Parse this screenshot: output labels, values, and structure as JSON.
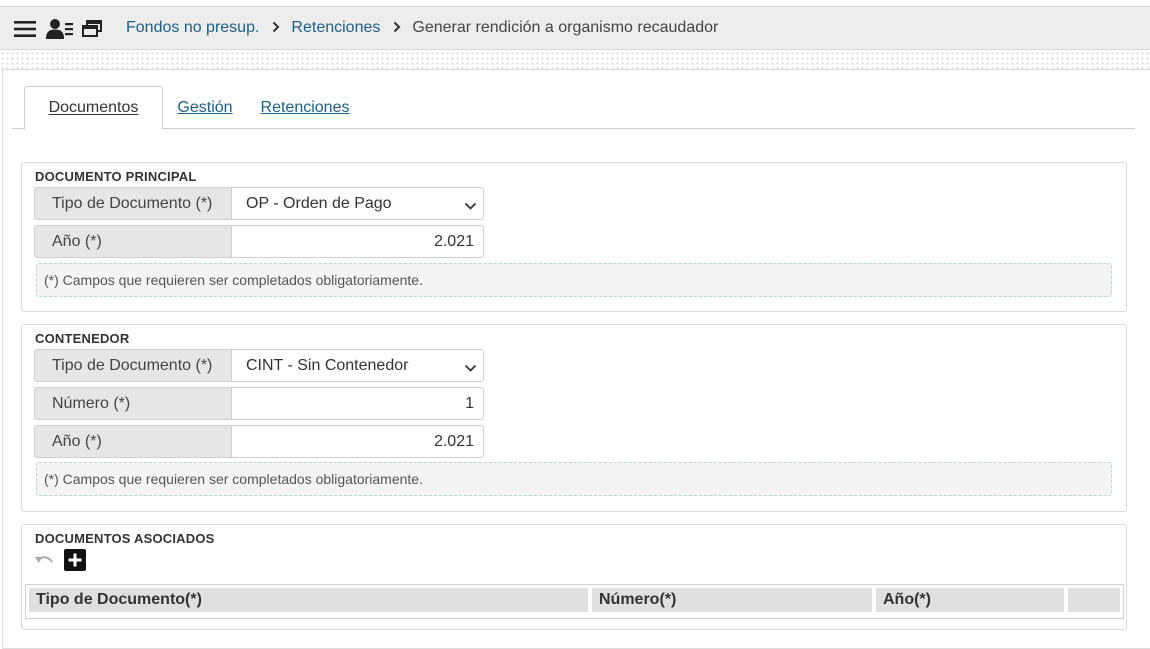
{
  "breadcrumb": {
    "items": [
      "Fondos no presup.",
      "Retenciones"
    ],
    "current": "Generar rendición a organismo recaudador",
    "separator": "›"
  },
  "tabs": [
    {
      "label": "Documentos",
      "active": true
    },
    {
      "label": "Gestión",
      "active": false
    },
    {
      "label": "Retenciones",
      "active": false
    }
  ],
  "documento_principal": {
    "title": "DOCUMENTO PRINCIPAL",
    "tipo_label": "Tipo de Documento (*)",
    "tipo_value": "OP - Orden de Pago",
    "anio_label": "Año (*)",
    "anio_value": "2.021",
    "note": "(*) Campos que requieren ser completados obligatoriamente."
  },
  "contenedor": {
    "title": "CONTENEDOR",
    "tipo_label": "Tipo de Documento (*)",
    "tipo_value": "CINT - Sin Contenedor",
    "numero_label": "Número (*)",
    "numero_value": "1",
    "anio_label": "Año (*)",
    "anio_value": "2.021",
    "note": "(*) Campos que requieren ser completados obligatoriamente."
  },
  "documentos_asociados": {
    "title": "DOCUMENTOS ASOCIADOS",
    "columns": [
      "Tipo de Documento(*)",
      "Número(*)",
      "Año(*)"
    ]
  },
  "icons": {
    "menu": "hamburger-menu-icon",
    "user": "user-list-icon",
    "windows": "windows-icon",
    "undo": "undo-icon",
    "add": "add-icon"
  },
  "colors": {
    "link": "#1d5f86",
    "header_bg": "#ededed",
    "label_bg": "#e6e6e6",
    "note_border": "#b8d8d3"
  }
}
